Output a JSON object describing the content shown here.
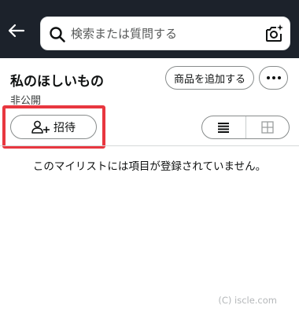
{
  "header": {
    "search": {
      "placeholder": "検索または質問する",
      "value": ""
    }
  },
  "list": {
    "title": "私のほしいもの",
    "visibility": "非公開",
    "add_item_label": "商品を追加する",
    "invite_label": "招待",
    "empty_message": "このマイリストには項目が登録されていません。"
  },
  "view_toggle": {
    "selected": "list"
  },
  "colors": {
    "header_bg": "#1c222b",
    "highlight": "#e8373f",
    "border": "#888c8c"
  },
  "watermark": "(C) iscle.com"
}
